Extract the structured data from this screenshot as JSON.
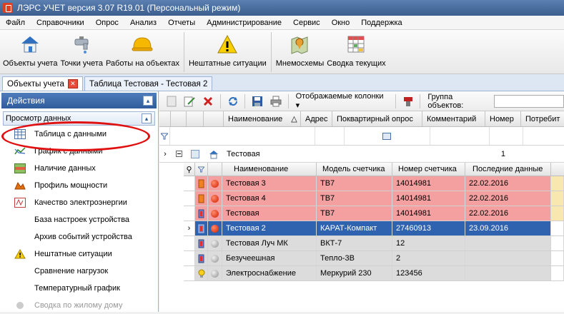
{
  "window": {
    "title": "ЛЭРС УЧЕТ версия 3.07 R19.01 (Персональный режим)"
  },
  "menu": [
    "Файл",
    "Справочники",
    "Опрос",
    "Анализ",
    "Отчеты",
    "Администрирование",
    "Сервис",
    "Окно",
    "Поддержка"
  ],
  "toolbar": {
    "objects": "Объекты учета",
    "points": "Точки учета",
    "work": "Работы на объектах",
    "emergency": "Нештатные ситуации",
    "schemes": "Мнемосхемы",
    "summary": "Сводка текущих"
  },
  "doc_tabs": {
    "objects": "Объекты учета",
    "table": "Таблица Тестовая - Тестовая 2"
  },
  "left": {
    "header": "Действия",
    "section": "Просмотр данных",
    "items": [
      "Таблица с данными",
      "График с данными",
      "Наличие данных",
      "Профиль мощности",
      "Качество электроэнергии",
      "База настроек устройства",
      "Архив событий устройства",
      "Нештатные ситуации",
      "Сравнение нагрузок",
      "Температурный график",
      "Сводка по жилому дому"
    ]
  },
  "right_toolbar": {
    "columns": "Отображаемые колонки",
    "group_label": "Группа объектов:"
  },
  "grid": {
    "headers": [
      "Наименование",
      "Адрес",
      "Поквартирный опрос",
      "Комментарий",
      "Номер",
      "Потребит"
    ],
    "group_row": {
      "name": "Тестовая",
      "number": "1"
    },
    "sub_headers": [
      "Наименование",
      "Модель счетчика",
      "Номер счетчика",
      "Последние данные"
    ],
    "rows": [
      {
        "name": "Тестовая 3",
        "model": "ТВ7",
        "serial": "14014981",
        "last": "22.02.2016",
        "style": "red"
      },
      {
        "name": "Тестовая 4",
        "model": "ТВ7",
        "serial": "14014981",
        "last": "22.02.2016",
        "style": "red"
      },
      {
        "name": "Тестовая",
        "model": "ТВ7",
        "serial": "14014981",
        "last": "22.02.2016",
        "style": "red"
      },
      {
        "name": "Тестовая 2",
        "model": "КАРАТ-Компакт",
        "serial": "27460913",
        "last": "23.09.2016",
        "style": "sel"
      },
      {
        "name": "Тестовая Луч МК",
        "model": "ВКТ-7",
        "serial": "12",
        "last": "",
        "style": "grey"
      },
      {
        "name": "Безучеешная",
        "model": "Тепло-3В",
        "serial": "2",
        "last": "",
        "style": "grey"
      },
      {
        "name": "Электроснабжение",
        "model": "Меркурий 230",
        "serial": "123456",
        "last": "",
        "style": "grey"
      }
    ]
  },
  "colors": {
    "red_row": "#f4a0a0",
    "selected_row": "#2f63b0",
    "grey_row": "#dcdcdc",
    "accent": "#2f5c9c"
  }
}
